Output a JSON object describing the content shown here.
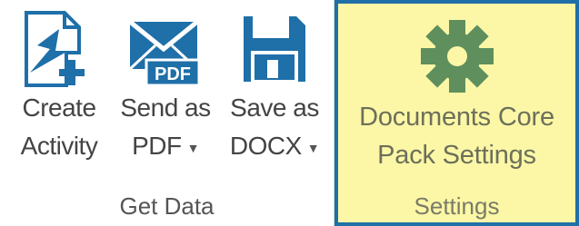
{
  "groups": {
    "get_data": {
      "label": "Get Data",
      "buttons": {
        "create": {
          "line1": "Create",
          "line2": "Activity",
          "icon": "create-activity-icon"
        },
        "send_pdf": {
          "line1": "Send as",
          "line2": "PDF",
          "icon": "send-pdf-icon",
          "pdf_badge": "PDF"
        },
        "save_docx": {
          "line1": "Save as",
          "line2": "DOCX",
          "icon": "save-disk-icon"
        }
      }
    },
    "settings": {
      "label": "Settings",
      "button": {
        "line1": "Documents Core",
        "line2": "Pack Settings",
        "icon": "gear-icon"
      }
    }
  },
  "colors": {
    "icon_blue": "#1f6fa8",
    "gear_green": "#5f8f5d",
    "settings_bg": "#fbf7a6",
    "selection_border": "#1f6fa8"
  }
}
